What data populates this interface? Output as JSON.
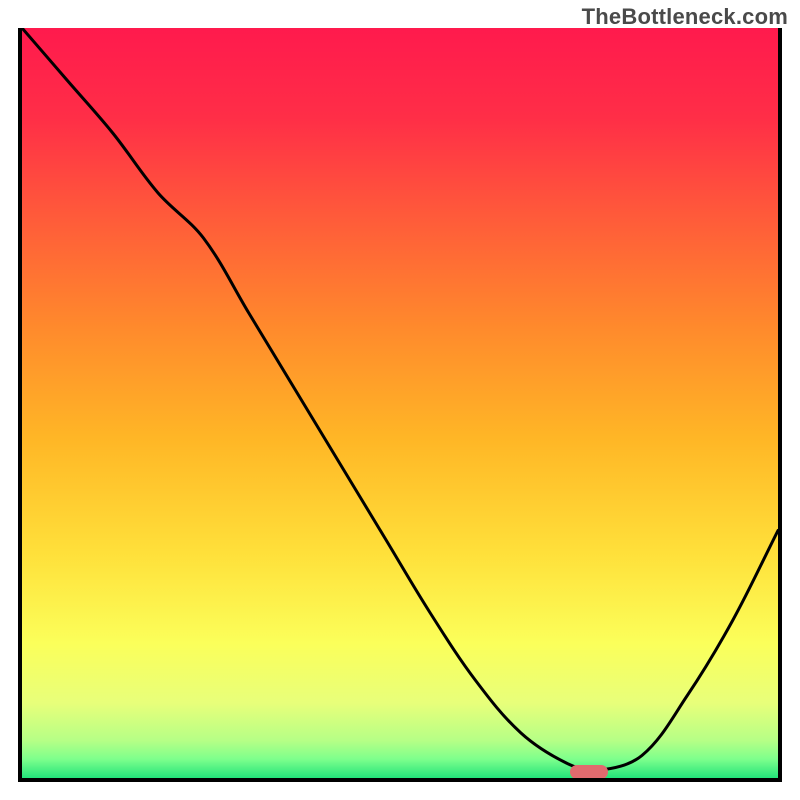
{
  "watermark": "TheBottleneck.com",
  "chart_data": {
    "type": "line",
    "title": "",
    "xlabel": "",
    "ylabel": "",
    "xlim": [
      0,
      100
    ],
    "ylim": [
      0,
      100
    ],
    "grid": false,
    "series": [
      {
        "name": "bottleneck-curve",
        "x": [
          0,
          6,
          12,
          18,
          24,
          30,
          36,
          42,
          48,
          54,
          60,
          66,
          72,
          76,
          82,
          88,
          94,
          100
        ],
        "y": [
          100,
          93,
          86,
          78,
          72,
          62,
          52,
          42,
          32,
          22,
          13,
          6,
          2,
          1,
          3,
          11,
          21,
          33
        ]
      }
    ],
    "gradient_stops": [
      {
        "offset": 0.0,
        "color": "#ff1a4d"
      },
      {
        "offset": 0.12,
        "color": "#ff2e47"
      },
      {
        "offset": 0.25,
        "color": "#ff5a3a"
      },
      {
        "offset": 0.4,
        "color": "#ff8a2c"
      },
      {
        "offset": 0.55,
        "color": "#ffb726"
      },
      {
        "offset": 0.7,
        "color": "#ffe03a"
      },
      {
        "offset": 0.82,
        "color": "#fbff5a"
      },
      {
        "offset": 0.9,
        "color": "#e8ff7a"
      },
      {
        "offset": 0.95,
        "color": "#b6ff86"
      },
      {
        "offset": 0.975,
        "color": "#7dff8c"
      },
      {
        "offset": 1.0,
        "color": "#23e37a"
      }
    ],
    "marker": {
      "name": "optimal-point",
      "x": 75,
      "y": 0.8,
      "color": "#e06a6e"
    }
  }
}
